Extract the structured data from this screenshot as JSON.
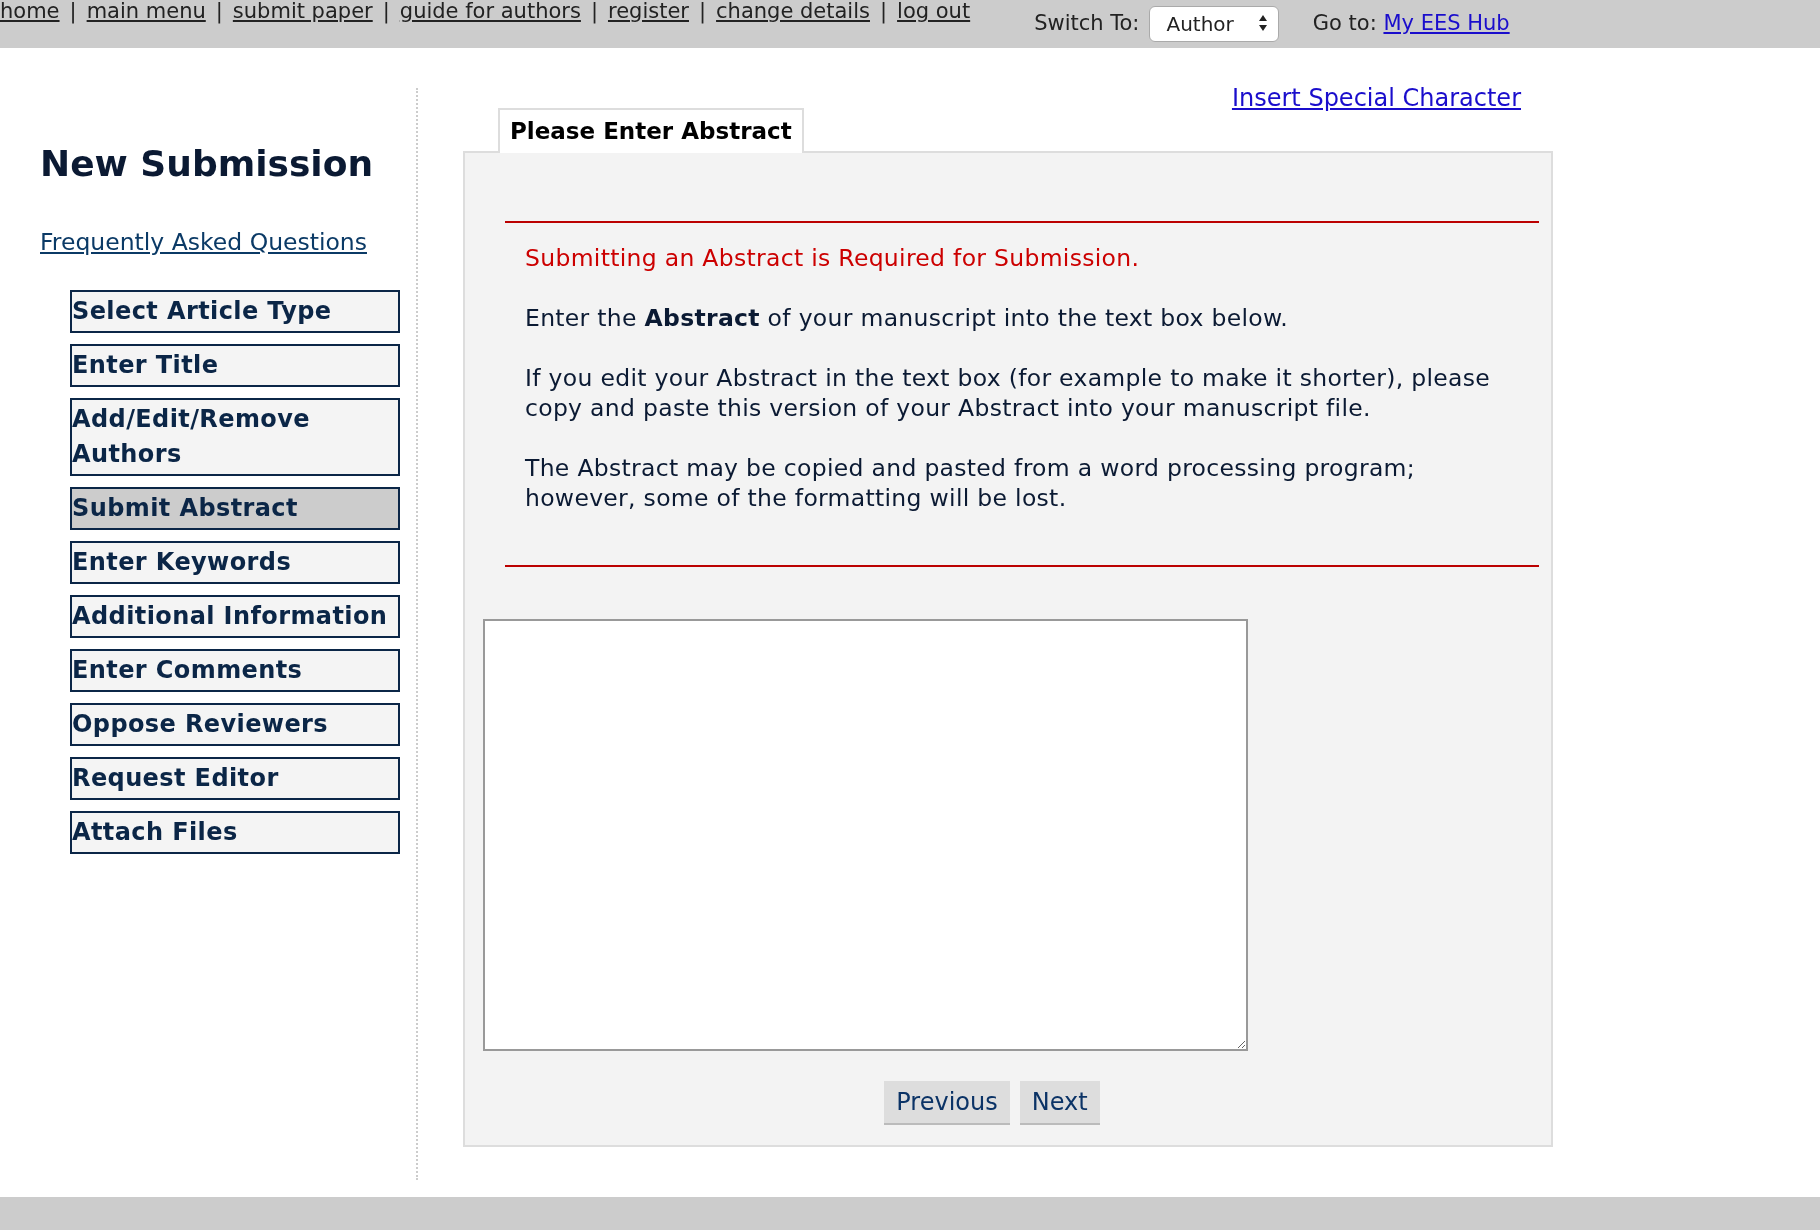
{
  "top_links": [
    "home",
    "main menu",
    "submit paper",
    "guide for authors",
    "register",
    "change details",
    "log out"
  ],
  "link_separator": "|",
  "switch_to": {
    "label": "Switch To:",
    "value": "Author"
  },
  "go_to": {
    "label": "Go to:",
    "link": "My EES Hub"
  },
  "sidebar": {
    "title": "New Submission",
    "faq": "Frequently Asked Questions",
    "items": [
      {
        "label": "Select Article Type",
        "selected": false
      },
      {
        "label": "Enter Title",
        "selected": false
      },
      {
        "label": "Add/Edit/Remove Authors",
        "selected": false
      },
      {
        "label": "Submit Abstract",
        "selected": true
      },
      {
        "label": "Enter Keywords",
        "selected": false
      },
      {
        "label": "Additional Information",
        "selected": false
      },
      {
        "label": "Enter Comments",
        "selected": false
      },
      {
        "label": "Oppose Reviewers",
        "selected": false
      },
      {
        "label": "Request Editor",
        "selected": false
      },
      {
        "label": "Attach Files",
        "selected": false
      }
    ]
  },
  "special_char_link": "Insert Special Character",
  "tab": "Please Enter Abstract",
  "notice": "Submitting an Abstract is Required for Submission.",
  "paragraphs": [
    "Enter the **Abstract** of your manuscript into the text box below.",
    "If you edit your Abstract in the text box (for example to make it shorter), please copy and paste this version of your Abstract into your manuscript file.",
    "The Abstract may be copied and pasted from a word processing program; however, some of the formatting will be lost."
  ],
  "buttons": [
    "Previous",
    "Next"
  ]
}
